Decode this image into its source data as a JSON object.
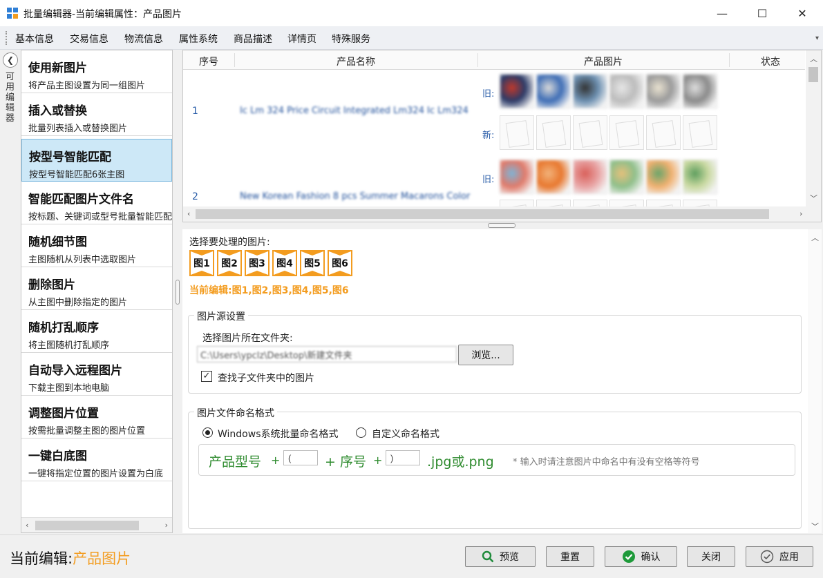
{
  "window": {
    "title": "批量编辑器-当前编辑属性：产品图片",
    "minimize": "—",
    "maximize": "☐",
    "close": "✕"
  },
  "menu": [
    "基本信息",
    "交易信息",
    "物流信息",
    "属性系统",
    "商品描述",
    "详情页",
    "特殊服务"
  ],
  "sidebar": {
    "vertical_label": "可用编辑器",
    "items": [
      {
        "title": "使用新图片",
        "desc": "将产品主图设置为同一组图片"
      },
      {
        "title": "插入或替换",
        "desc": "批量列表插入或替换图片"
      },
      {
        "title": "按型号智能匹配",
        "desc": "按型号智能匹配6张主图"
      },
      {
        "title": "智能匹配图片文件名",
        "desc": "按标题、关键词或型号批量智能匹配"
      },
      {
        "title": "随机细节图",
        "desc": "主图随机从列表中选取图片"
      },
      {
        "title": "删除图片",
        "desc": "从主图中删除指定的图片"
      },
      {
        "title": "随机打乱顺序",
        "desc": "将主图随机打乱顺序"
      },
      {
        "title": "自动导入远程图片",
        "desc": "下载主图到本地电脑"
      },
      {
        "title": "调整图片位置",
        "desc": "按需批量调整主图的图片位置"
      },
      {
        "title": "一键白底图",
        "desc": "一键将指定位置的图片设置为白底"
      }
    ]
  },
  "grid": {
    "columns": [
      "序号",
      "产品名称",
      "产品图片",
      "状态"
    ],
    "rows": [
      {
        "index": "1",
        "name": "Ic Lm 324 Price Circuit Integrated Lm324 Ic Lm324",
        "old_label": "旧:",
        "new_label": "新:",
        "old_colors": [
          [
            "#2b3a67",
            "#c0392b"
          ],
          [
            "#3e6db5",
            "#d9d9d9"
          ],
          [
            "#6c8fb0",
            "#333"
          ],
          [
            "#bcbcbc",
            "#e6e6e6"
          ],
          [
            "#9a9a9a",
            "#e9e2d0"
          ],
          [
            "#8a8a8a",
            "#dddddd"
          ]
        ]
      },
      {
        "index": "2",
        "name": "New Korean Fashion 8 pcs Summer Macarons Color",
        "old_label": "旧:",
        "old_colors": [
          [
            "#e07a6a",
            "#7fb3d5"
          ],
          [
            "#e8782f",
            "#f2b27a"
          ],
          [
            "#e8a2a2",
            "#d9605a"
          ],
          [
            "#8fbf8a",
            "#e5c07b"
          ],
          [
            "#f0b070",
            "#6aa56a"
          ],
          [
            "#c8d8a0",
            "#5e9e5e"
          ]
        ]
      }
    ]
  },
  "settings": {
    "pick_label": "选择要处理的图片:",
    "chips": [
      "图1",
      "图2",
      "图3",
      "图4",
      "图5",
      "图6"
    ],
    "current_selection": "当前编辑:图1,图2,图3,图4,图5,图6",
    "source_group": {
      "title": "图片源设置",
      "folder_label": "选择图片所在文件夹:",
      "folder_value": "C:\\Users\\ypclz\\Desktop\\新建文件夹",
      "browse": "浏览...",
      "subfolder_label": "查找子文件夹中的图片",
      "subfolder_checked": "✓"
    },
    "naming_group": {
      "title": "图片文件命名格式",
      "option_windows": "Windows系统批量命名格式",
      "option_custom": "自定义命名格式",
      "fmt_model": "产品型号",
      "plus": "+",
      "prefix_value": "(",
      "fmt_seq": "+ 序号",
      "suffix_value": ")",
      "fmt_ext": ".jpg或.png",
      "note": "* 输入时请注意图片中命名中有没有空格等符号"
    }
  },
  "footer": {
    "label": "当前编辑:",
    "value": "产品图片",
    "preview": "预览",
    "reset": "重置",
    "confirm": "确认",
    "close": "关闭",
    "apply": "应用"
  },
  "colors": {
    "accent_orange": "#f39c1f",
    "selected_bg": "#cde8f7",
    "format_green": "#2e8b2e",
    "link_blue": "#2a5da8"
  }
}
